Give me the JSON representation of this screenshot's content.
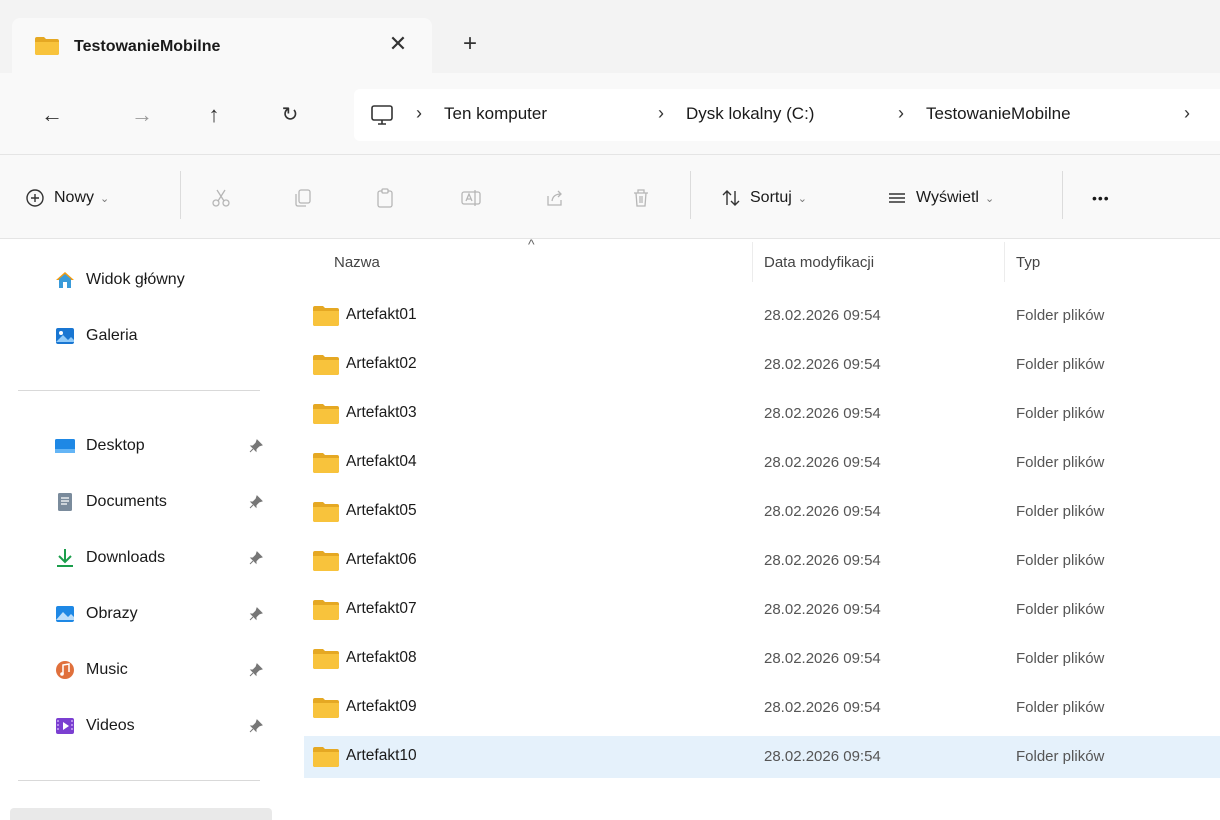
{
  "tab": {
    "title": "TestowanieMobilne",
    "close_glyph": "✕",
    "new_glyph": "+",
    "icon": "folder-icon"
  },
  "nav": {
    "back_glyph": "←",
    "forward_glyph": "→",
    "up_glyph": "↑",
    "refresh_glyph": "↻",
    "breadcrumb": [
      "Ten komputer",
      "Dysk lokalny (C:)",
      "TestowanieMobilne"
    ],
    "separator": "›"
  },
  "commands": {
    "new_label": "Nowy",
    "sort_label": "Sortuj",
    "view_label": "Wyświetl",
    "more_glyph": "•••",
    "chevron": "⌄"
  },
  "sidebar": {
    "top_items": [
      {
        "label": "Widok główny",
        "icon": "home-icon"
      },
      {
        "label": "Galeria",
        "icon": "gallery-icon"
      }
    ],
    "pinned_items": [
      {
        "label": "Desktop",
        "icon": "desktop-icon"
      },
      {
        "label": "Documents",
        "icon": "documents-icon"
      },
      {
        "label": "Downloads",
        "icon": "downloads-icon"
      },
      {
        "label": "Obrazy",
        "icon": "pictures-icon"
      },
      {
        "label": "Music",
        "icon": "music-icon"
      },
      {
        "label": "Videos",
        "icon": "videos-icon"
      }
    ]
  },
  "list": {
    "columns": {
      "name": "Nazwa",
      "date": "Data modyfikacji",
      "type": "Typ"
    },
    "sort_indicator": "^",
    "rows": [
      {
        "name": "Artefakt01",
        "date": "28.02.2026 09:54",
        "type": "Folder plików"
      },
      {
        "name": "Artefakt02",
        "date": "28.02.2026 09:54",
        "type": "Folder plików"
      },
      {
        "name": "Artefakt03",
        "date": "28.02.2026 09:54",
        "type": "Folder plików"
      },
      {
        "name": "Artefakt04",
        "date": "28.02.2026 09:54",
        "type": "Folder plików"
      },
      {
        "name": "Artefakt05",
        "date": "28.02.2026 09:54",
        "type": "Folder plików"
      },
      {
        "name": "Artefakt06",
        "date": "28.02.2026 09:54",
        "type": "Folder plików"
      },
      {
        "name": "Artefakt07",
        "date": "28.02.2026 09:54",
        "type": "Folder plików"
      },
      {
        "name": "Artefakt08",
        "date": "28.02.2026 09:54",
        "type": "Folder plików"
      },
      {
        "name": "Artefakt09",
        "date": "28.02.2026 09:54",
        "type": "Folder plików"
      },
      {
        "name": "Artefakt10",
        "date": "28.02.2026 09:54",
        "type": "Folder plików",
        "selected": true
      }
    ]
  },
  "colors": {
    "folder": "#f8c33c",
    "folder_dark": "#e5a823",
    "selection": "#e5f1fb",
    "accent": "#0067c0"
  }
}
